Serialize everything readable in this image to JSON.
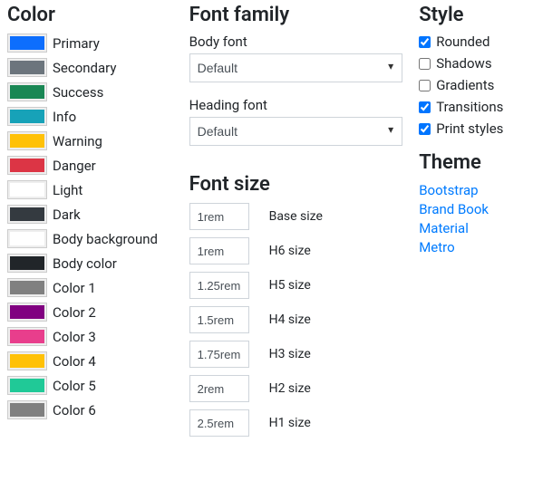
{
  "headings": {
    "color": "Color",
    "font_family": "Font family",
    "font_size": "Font size",
    "style": "Style",
    "theme": "Theme"
  },
  "colors": [
    {
      "label": "Primary",
      "hex": "#0d6efd"
    },
    {
      "label": "Secondary",
      "hex": "#6c757d"
    },
    {
      "label": "Success",
      "hex": "#198754"
    },
    {
      "label": "Info",
      "hex": "#17a2b8"
    },
    {
      "label": "Warning",
      "hex": "#ffc107"
    },
    {
      "label": "Danger",
      "hex": "#dc3545"
    },
    {
      "label": "Light",
      "hex": "#ffffff"
    },
    {
      "label": "Dark",
      "hex": "#343a40"
    },
    {
      "label": "Body background",
      "hex": "#ffffff"
    },
    {
      "label": "Body color",
      "hex": "#212529"
    },
    {
      "label": "Color 1",
      "hex": "#808080"
    },
    {
      "label": "Color 2",
      "hex": "#800080"
    },
    {
      "label": "Color 3",
      "hex": "#e83e8c"
    },
    {
      "label": "Color 4",
      "hex": "#ffc107"
    },
    {
      "label": "Color 5",
      "hex": "#20c997"
    },
    {
      "label": "Color 6",
      "hex": "#808080"
    }
  ],
  "font_family": {
    "body_label": "Body font",
    "body_value": "Default",
    "heading_label": "Heading font",
    "heading_value": "Default"
  },
  "font_sizes": [
    {
      "value": "1rem",
      "label": "Base size"
    },
    {
      "value": "1rem",
      "label": "H6 size"
    },
    {
      "value": "1.25rem",
      "label": "H5 size"
    },
    {
      "value": "1.5rem",
      "label": "H4 size"
    },
    {
      "value": "1.75rem",
      "label": "H3 size"
    },
    {
      "value": "2rem",
      "label": "H2 size"
    },
    {
      "value": "2.5rem",
      "label": "H1 size"
    }
  ],
  "style_options": [
    {
      "label": "Rounded",
      "checked": true
    },
    {
      "label": "Shadows",
      "checked": false
    },
    {
      "label": "Gradients",
      "checked": false
    },
    {
      "label": "Transitions",
      "checked": true
    },
    {
      "label": "Print styles",
      "checked": true
    }
  ],
  "themes": [
    {
      "label": "Bootstrap"
    },
    {
      "label": "Brand Book"
    },
    {
      "label": "Material"
    },
    {
      "label": "Metro"
    }
  ]
}
